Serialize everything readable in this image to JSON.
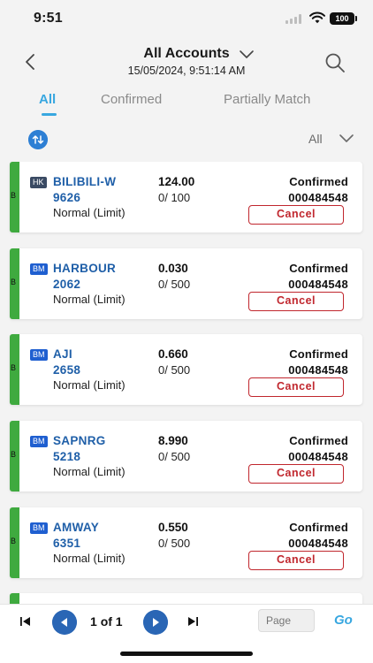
{
  "status_bar": {
    "time": "9:51",
    "battery": "100"
  },
  "header": {
    "title": "All Accounts",
    "subtitle": "15/05/2024, 9:51:14 AM"
  },
  "tabs": [
    {
      "label": "All",
      "active": true
    },
    {
      "label": "Confirmed",
      "active": false
    },
    {
      "label": "Partially Match",
      "active": false
    }
  ],
  "filter": {
    "selected": "All"
  },
  "orders": [
    {
      "side": "B",
      "market": "HK",
      "name": "BILIBILI-W",
      "code": "9626",
      "type": "Normal (Limit)",
      "price": "124.00",
      "qty": "0/ 100",
      "status": "Confirmed",
      "order_no": "000484548",
      "action": "Cancel"
    },
    {
      "side": "B",
      "market": "BM",
      "name": "HARBOUR",
      "code": "2062",
      "type": "Normal (Limit)",
      "price": "0.030",
      "qty": "0/ 500",
      "status": "Confirmed",
      "order_no": "000484548",
      "action": "Cancel"
    },
    {
      "side": "B",
      "market": "BM",
      "name": "AJI",
      "code": "2658",
      "type": "Normal (Limit)",
      "price": "0.660",
      "qty": "0/ 500",
      "status": "Confirmed",
      "order_no": "000484548",
      "action": "Cancel"
    },
    {
      "side": "B",
      "market": "BM",
      "name": "SAPNRG",
      "code": "5218",
      "type": "Normal (Limit)",
      "price": "8.990",
      "qty": "0/ 500",
      "status": "Confirmed",
      "order_no": "000484548",
      "action": "Cancel"
    },
    {
      "side": "B",
      "market": "BM",
      "name": "AMWAY",
      "code": "6351",
      "type": "Normal (Limit)",
      "price": "0.550",
      "qty": "0/ 500",
      "status": "Confirmed",
      "order_no": "000484548",
      "action": "Cancel"
    }
  ],
  "pagination": {
    "current": "1",
    "of_label": "of",
    "total": "1",
    "page_placeholder": "Page",
    "go_label": "Go"
  },
  "colors": {
    "accent": "#38a7e0",
    "buy_strip": "#3faa3f",
    "cancel": "#c0262d",
    "stock": "#1f5fa8",
    "hk_badge": "#3a4a63",
    "bm_badge": "#1f5fd0",
    "pager_button": "#2a66b5"
  },
  "icons": {
    "back": "chevron-left-icon",
    "search": "search-icon",
    "dropdown": "chevron-down-icon",
    "sort": "sort-arrows-icon",
    "first": "first-page-icon",
    "prev": "previous-page-icon",
    "next": "next-page-icon",
    "last": "last-page-icon"
  }
}
